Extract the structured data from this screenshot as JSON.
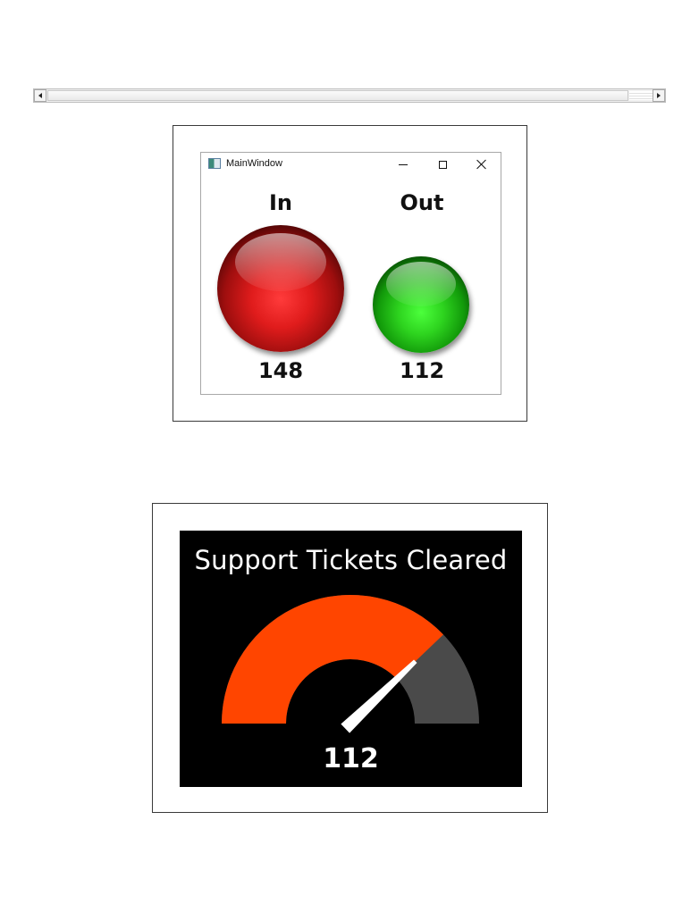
{
  "scrollbar": {
    "left_icon": "scroll-left-arrow-icon",
    "right_icon": "scroll-right-arrow-icon"
  },
  "window": {
    "title": "MainWindow",
    "icon": "app-window-icon",
    "controls": {
      "minimize_icon": "minimize-icon",
      "maximize_icon": "maximize-icon",
      "close_icon": "close-icon"
    },
    "lamps": [
      {
        "label": "In",
        "value": "148",
        "color": "#e01c1c"
      },
      {
        "label": "Out",
        "value": "112",
        "color": "#2ed41f"
      }
    ]
  },
  "gauge": {
    "title": "Support Tickets Cleared",
    "value": "112",
    "fill_color": "#ff4500",
    "track_color": "#4a4a4a",
    "background": "#000000",
    "needle_color": "#ffffff"
  },
  "chart_data": {
    "type": "gauge",
    "title": "Support Tickets Cleared",
    "value": 112,
    "min": 0,
    "max": 148
  }
}
